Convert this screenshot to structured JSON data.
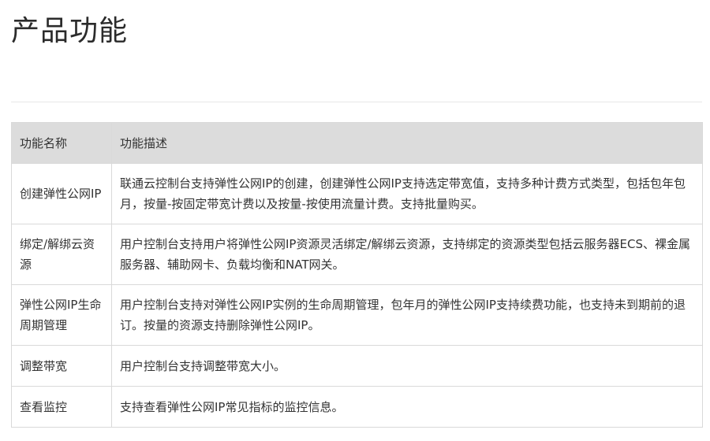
{
  "page": {
    "title": "产品功能"
  },
  "table": {
    "headers": [
      "功能名称",
      "功能描述"
    ],
    "rows": [
      {
        "name": "创建弹性公网IP",
        "description": "联通云控制台支持弹性公网IP的创建，创建弹性公网IP支持选定带宽值，支持多种计费方式类型，包括包年包月，按量-按固定带宽计费以及按量-按使用流量计费。支持批量购买。"
      },
      {
        "name": "绑定/解绑云资源",
        "description": "用户控制台支持用户将弹性公网IP资源灵活绑定/解绑云资源，支持绑定的资源类型包括云服务器ECS、裸金属服务器、辅助网卡、负载均衡和NAT网关。"
      },
      {
        "name": "弹性公网IP生命周期管理",
        "description": "用户控制台支持对弹性公网IP实例的生命周期管理，包年月的弹性公网IP支持续费功能，也支持未到期前的退订。按量的资源支持删除弹性公网IP。"
      },
      {
        "name": "调整带宽",
        "description": "用户控制台支持调整带宽大小。"
      },
      {
        "name": "查看监控",
        "description": "支持查看弹性公网IP常见指标的监控信息。"
      }
    ]
  }
}
